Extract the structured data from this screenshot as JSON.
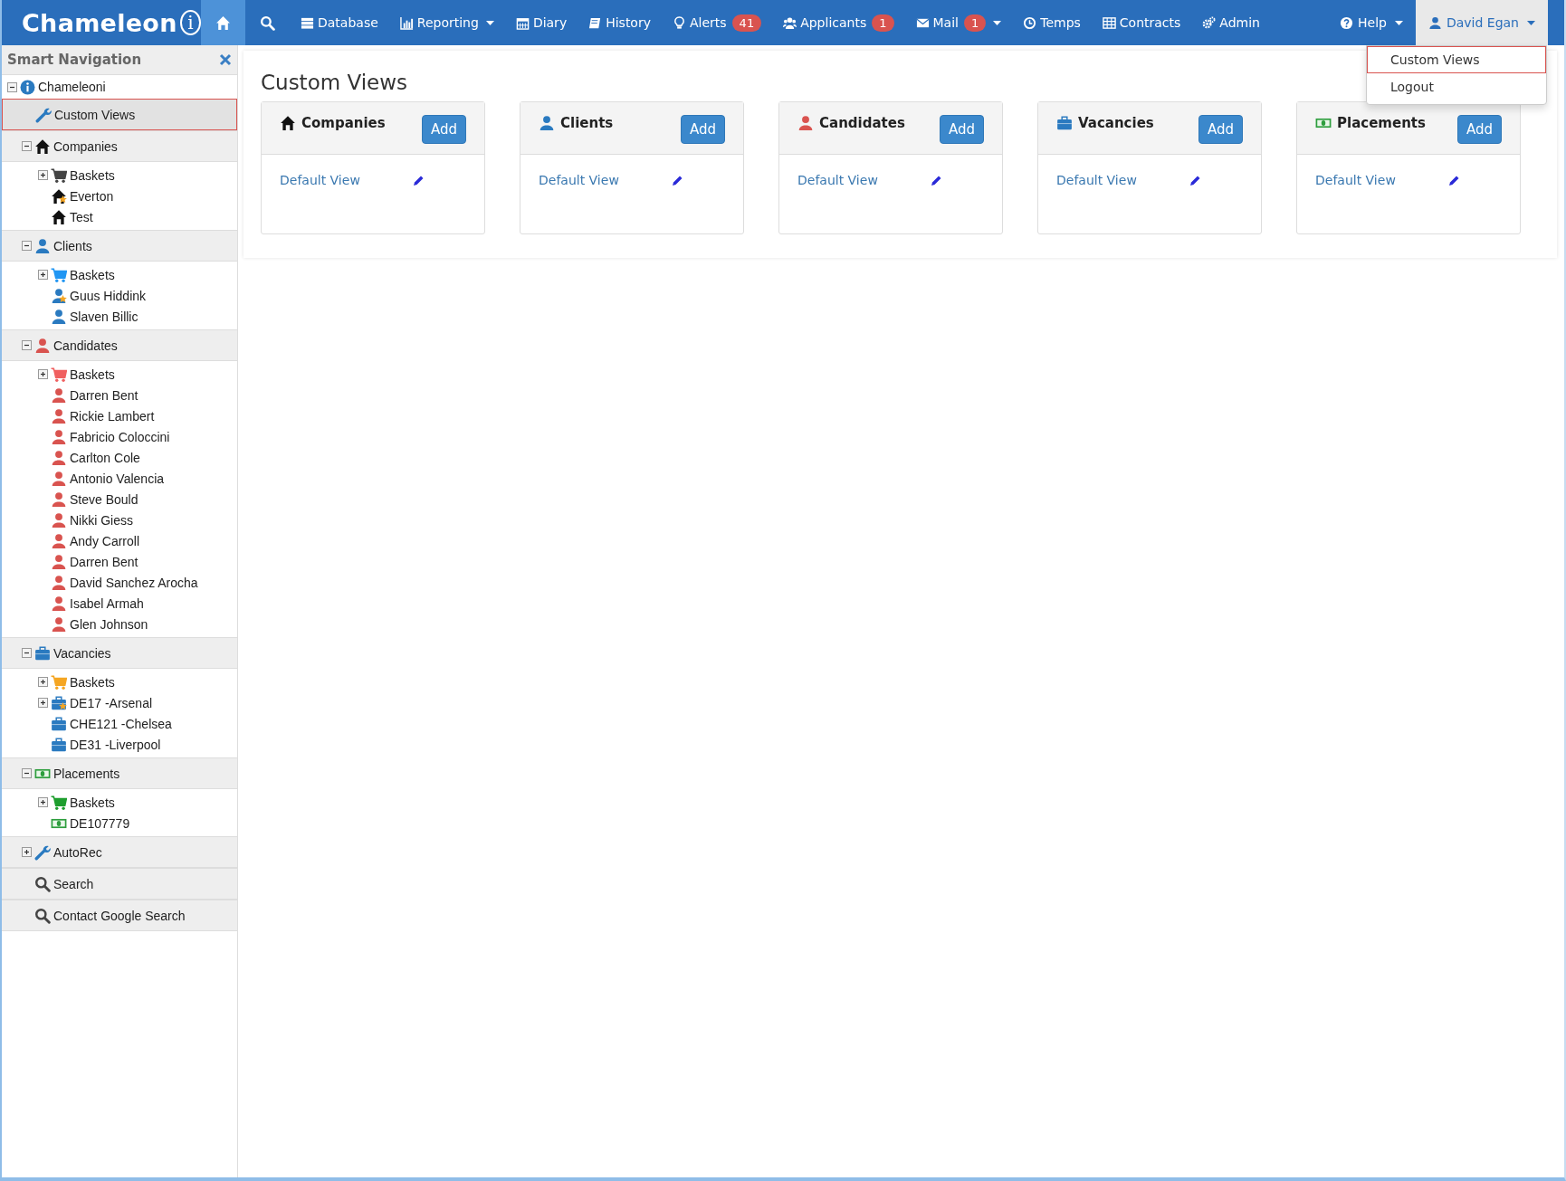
{
  "brand": {
    "name": "Chameleon",
    "mark": "i"
  },
  "nav": [
    {
      "kind": "home",
      "selected": true,
      "caret": false
    },
    {
      "kind": "search",
      "selected": false,
      "caret": false
    },
    {
      "kind": "database",
      "label": "Database",
      "selected": false,
      "caret": false
    },
    {
      "kind": "chart",
      "label": "Reporting",
      "selected": false,
      "caret": true
    },
    {
      "kind": "calendar",
      "label": "Diary",
      "selected": false,
      "caret": false
    },
    {
      "kind": "book",
      "label": "History",
      "selected": false,
      "caret": false
    },
    {
      "kind": "bulb",
      "label": "Alerts",
      "badge": "41",
      "selected": false,
      "caret": false
    },
    {
      "kind": "users",
      "label": "Applicants",
      "badge": "1",
      "selected": false,
      "caret": false
    },
    {
      "kind": "mail",
      "label": "Mail",
      "badge": "1",
      "selected": false,
      "caret": true
    },
    {
      "kind": "clock",
      "label": "Temps",
      "selected": false,
      "caret": false
    },
    {
      "kind": "table",
      "label": "Contracts",
      "selected": false,
      "caret": false
    },
    {
      "kind": "gears",
      "label": "Admin",
      "selected": false,
      "caret": false
    }
  ],
  "nav_right": [
    {
      "kind": "help",
      "label": "Help",
      "caret": true,
      "open": false
    },
    {
      "kind": "user",
      "label": "David Egan",
      "caret": true,
      "open": true
    }
  ],
  "user_menu": [
    {
      "label": "Custom Views",
      "selected": true
    },
    {
      "label": "Logout",
      "selected": false
    }
  ],
  "sidebar": {
    "title": "Smart Navigation",
    "items": [
      {
        "label": "Chameleoni",
        "kind": "info",
        "color": "#2a7ac0",
        "expanded": true,
        "children": [
          {
            "label": "Custom Views",
            "kind": "wrench",
            "color": "#2a7ac0",
            "selected": true
          },
          {
            "label": "Companies",
            "kind": "home",
            "color": "#111111",
            "expanded": true,
            "selected": false,
            "children": [
              {
                "label": "Baskets",
                "kind": "cart",
                "color": "#444444",
                "expanded": false,
                "starred": false
              },
              {
                "label": "Everton",
                "kind": "home",
                "color": "#111111",
                "starred": true
              },
              {
                "label": "Test",
                "kind": "home",
                "color": "#111111",
                "starred": false
              }
            ]
          },
          {
            "label": "Clients",
            "kind": "user",
            "color": "#2a7ac0",
            "expanded": true,
            "selected": false,
            "children": [
              {
                "label": "Baskets",
                "kind": "cart",
                "color": "#2196f3",
                "expanded": false,
                "starred": false
              },
              {
                "label": "Guus Hiddink",
                "kind": "user",
                "color": "#2a7ac0",
                "starred": true
              },
              {
                "label": "Slaven Billic",
                "kind": "user",
                "color": "#2a7ac0",
                "starred": false
              }
            ]
          },
          {
            "label": "Candidates",
            "kind": "user",
            "color": "#d9534f",
            "expanded": true,
            "selected": false,
            "children": [
              {
                "label": "Baskets",
                "kind": "cart",
                "color": "#f06060",
                "expanded": false,
                "starred": false
              },
              {
                "label": "Darren Bent",
                "kind": "user",
                "color": "#d9534f",
                "starred": false
              },
              {
                "label": "Rickie Lambert",
                "kind": "user",
                "color": "#d9534f",
                "starred": false
              },
              {
                "label": "Fabricio Coloccini",
                "kind": "user",
                "color": "#d9534f",
                "starred": false
              },
              {
                "label": "Carlton Cole",
                "kind": "user",
                "color": "#d9534f",
                "starred": false
              },
              {
                "label": "Antonio Valencia",
                "kind": "user",
                "color": "#d9534f",
                "starred": false
              },
              {
                "label": "Steve Bould",
                "kind": "user",
                "color": "#d9534f",
                "starred": false
              },
              {
                "label": "Nikki Giess",
                "kind": "user",
                "color": "#d9534f",
                "starred": false
              },
              {
                "label": "Andy Carroll",
                "kind": "user",
                "color": "#d9534f",
                "starred": false
              },
              {
                "label": "Darren Bent",
                "kind": "user",
                "color": "#d9534f",
                "starred": false
              },
              {
                "label": "David Sanchez Arocha",
                "kind": "user",
                "color": "#d9534f",
                "starred": false
              },
              {
                "label": "Isabel Armah",
                "kind": "user",
                "color": "#d9534f",
                "starred": false
              },
              {
                "label": "Glen Johnson",
                "kind": "user",
                "color": "#d9534f",
                "starred": false
              }
            ]
          },
          {
            "label": "Vacancies",
            "kind": "briefcase",
            "color": "#2a7ac0",
            "expanded": true,
            "selected": false,
            "children": [
              {
                "label": "Baskets",
                "kind": "cart",
                "color": "#f5a623",
                "expanded": false,
                "starred": false
              },
              {
                "label": "DE17 -Arsenal",
                "kind": "briefcase",
                "color": "#2a7ac0",
                "expanded": false,
                "starred": true
              },
              {
                "label": "CHE121 -Chelsea",
                "kind": "briefcase",
                "color": "#2a7ac0",
                "starred": false
              },
              {
                "label": "DE31 -Liverpool",
                "kind": "briefcase",
                "color": "#2a7ac0",
                "starred": false
              }
            ]
          },
          {
            "label": "Placements",
            "kind": "money",
            "color": "#2e9e3e",
            "expanded": true,
            "selected": false,
            "children": [
              {
                "label": "Baskets",
                "kind": "cart",
                "color": "#1e9e2e",
                "expanded": false,
                "starred": false
              },
              {
                "label": "DE107779",
                "kind": "money",
                "color": "#2e9e3e",
                "starred": false
              }
            ]
          },
          {
            "label": "AutoRec",
            "kind": "wrench",
            "color": "#2a7ac0",
            "expanded": false,
            "selected": false
          },
          {
            "label": "Search",
            "kind": "search",
            "color": "#444444",
            "selected": false
          },
          {
            "label": "Contact Google Search",
            "kind": "search",
            "color": "#444444",
            "selected": false
          }
        ]
      }
    ]
  },
  "page_title": "Custom Views",
  "cards": [
    {
      "title": "Companies",
      "kind": "home",
      "color": "#111111",
      "button": "Add",
      "views": [
        {
          "label": "Default View"
        }
      ]
    },
    {
      "title": "Clients",
      "kind": "user",
      "color": "#2a7ac0",
      "button": "Add",
      "views": [
        {
          "label": "Default View"
        }
      ]
    },
    {
      "title": "Candidates",
      "kind": "user",
      "color": "#d9534f",
      "button": "Add",
      "views": [
        {
          "label": "Default View"
        }
      ]
    },
    {
      "title": "Vacancies",
      "kind": "briefcase",
      "color": "#2a7ac0",
      "button": "Add",
      "views": [
        {
          "label": "Default View"
        }
      ]
    },
    {
      "title": "Placements",
      "kind": "money",
      "color": "#2e9e3e",
      "button": "Add",
      "views": [
        {
          "label": "Default View"
        }
      ]
    }
  ]
}
